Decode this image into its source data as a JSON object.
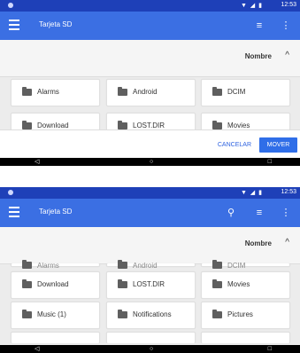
{
  "screen1": {
    "status": {
      "icons": "▼ ◢ ▮",
      "time": "12:53"
    },
    "appbar": {
      "title": "Tarjeta SD"
    },
    "sort": {
      "label": "Nombre",
      "chevron": "^"
    },
    "folders": [
      {
        "name": "Alarms"
      },
      {
        "name": "Android"
      },
      {
        "name": "DCIM"
      },
      {
        "name": "Download"
      },
      {
        "name": "LOST.DIR"
      },
      {
        "name": "Movies"
      }
    ],
    "actions": {
      "cancel_label": "CANCELAR",
      "move_label": "MOVER"
    },
    "nav": {
      "back": "◁",
      "home": "○",
      "recent": "□"
    }
  },
  "screen2": {
    "status": {
      "icons": "▼ ◢ ▮",
      "time": "12:53"
    },
    "appbar": {
      "title": "Tarjeta SD"
    },
    "sort": {
      "label": "Nombre",
      "chevron": "^"
    },
    "partial_folders": [
      {
        "name": "Alarms"
      },
      {
        "name": "Android"
      },
      {
        "name": "DCIM"
      }
    ],
    "folders": [
      {
        "name": "Download"
      },
      {
        "name": "LOST.DIR"
      },
      {
        "name": "Movies"
      },
      {
        "name": "Music (1)"
      },
      {
        "name": "Notifications"
      },
      {
        "name": "Pictures"
      }
    ],
    "nav": {
      "back": "◁",
      "home": "○",
      "recent": "□"
    }
  }
}
